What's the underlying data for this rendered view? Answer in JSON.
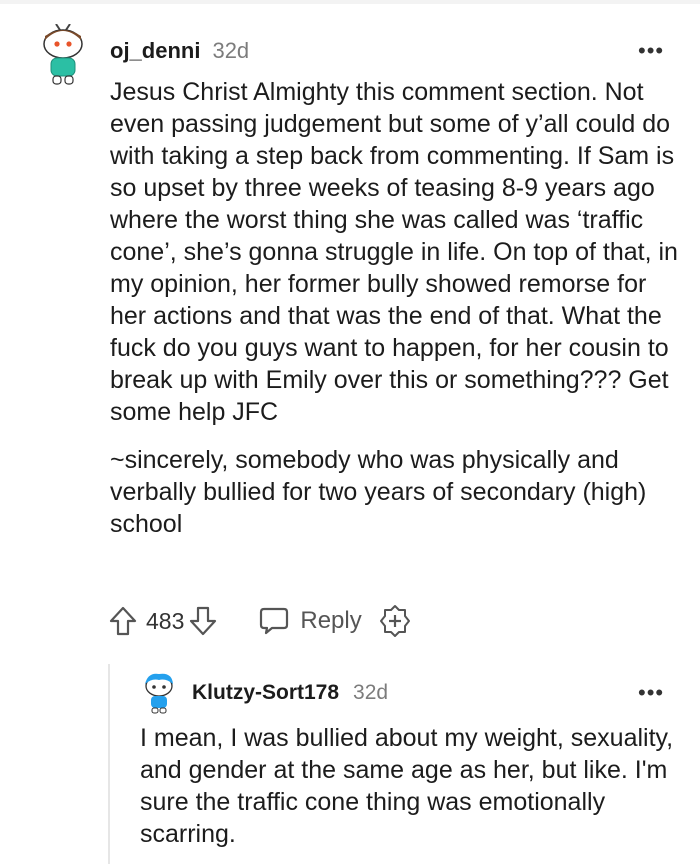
{
  "comment": {
    "username": "oj_denni",
    "age": "32d",
    "more_label": "•••",
    "paragraphs": [
      "Jesus Christ Almighty this comment section. Not even passing judgement but some of y’all could do with taking a step back from commenting. If Sam is so upset by three weeks of teasing 8-9 years ago where the worst thing she was called was ‘traffic cone’, she’s gonna struggle in life. On top of that, in my opinion, her former bully showed remorse for her actions and that was the end of that. What the fuck do you guys want to happen, for her cousin to break up with Emily over this or something??? Get some help JFC",
      "~sincerely, somebody who was physically and verbally bullied for two years of secondary (high) school"
    ],
    "score": "483",
    "reply_label": "Reply",
    "icons": {
      "avatar": "snoo-avatar-icon",
      "upvote": "upvote-arrow-icon",
      "downvote": "downvote-arrow-icon",
      "reply": "speech-bubble-icon",
      "award": "award-plus-icon",
      "more": "more-options-icon"
    }
  },
  "reply": {
    "username": "Klutzy-Sort178",
    "age": "32d",
    "more_label": "•••",
    "text": "I mean, I was bullied about my weight, sexuality, and gender at the same age as her, but like. I'm sure the traffic cone thing was emotionally scarring."
  },
  "colors": {
    "text": "#1c1c1c",
    "meta_gray": "#7c7c7c",
    "icon_gray": "#555555",
    "avatar_teal": "#2bbfa4",
    "avatar_blue": "#24a0ed"
  }
}
